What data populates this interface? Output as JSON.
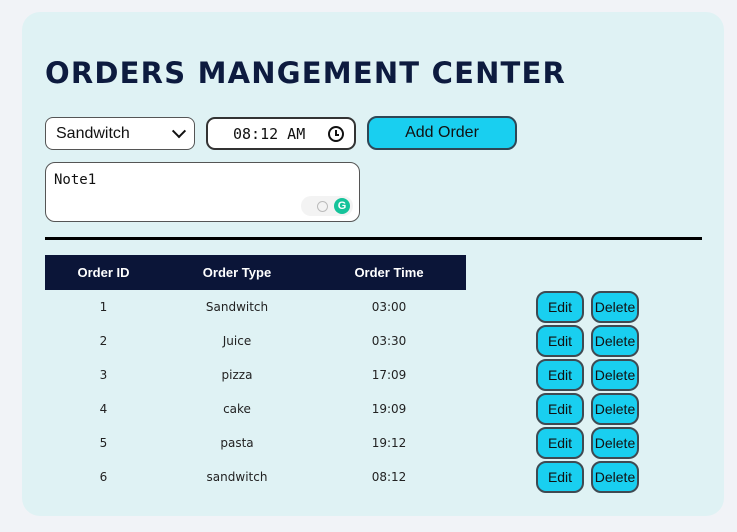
{
  "header": {
    "title": "ORDERS MANGEMENT CENTER"
  },
  "form": {
    "order_type_selected": "Sandwitch",
    "time_value": "08:12 AM",
    "add_button_label": "Add Order",
    "note_value": "Note1",
    "grammarly_icon_letter": "G"
  },
  "table": {
    "headers": [
      "Order ID",
      "Order Type",
      "Order Time"
    ],
    "edit_label": "Edit",
    "delete_label": "Delete",
    "rows": [
      {
        "id": "1",
        "type": "Sandwitch",
        "time": "03:00"
      },
      {
        "id": "2",
        "type": "Juice",
        "time": "03:30"
      },
      {
        "id": "3",
        "type": "pizza",
        "time": "17:09"
      },
      {
        "id": "4",
        "type": "cake",
        "time": "19:09"
      },
      {
        "id": "5",
        "type": "pasta",
        "time": "19:12"
      },
      {
        "id": "6",
        "type": "sandwitch",
        "time": "08:12"
      }
    ]
  },
  "colors": {
    "accent": "#19cff0",
    "header_bg": "#0b1538",
    "card_bg": "#dff2f4",
    "title": "#0d1b3f"
  }
}
